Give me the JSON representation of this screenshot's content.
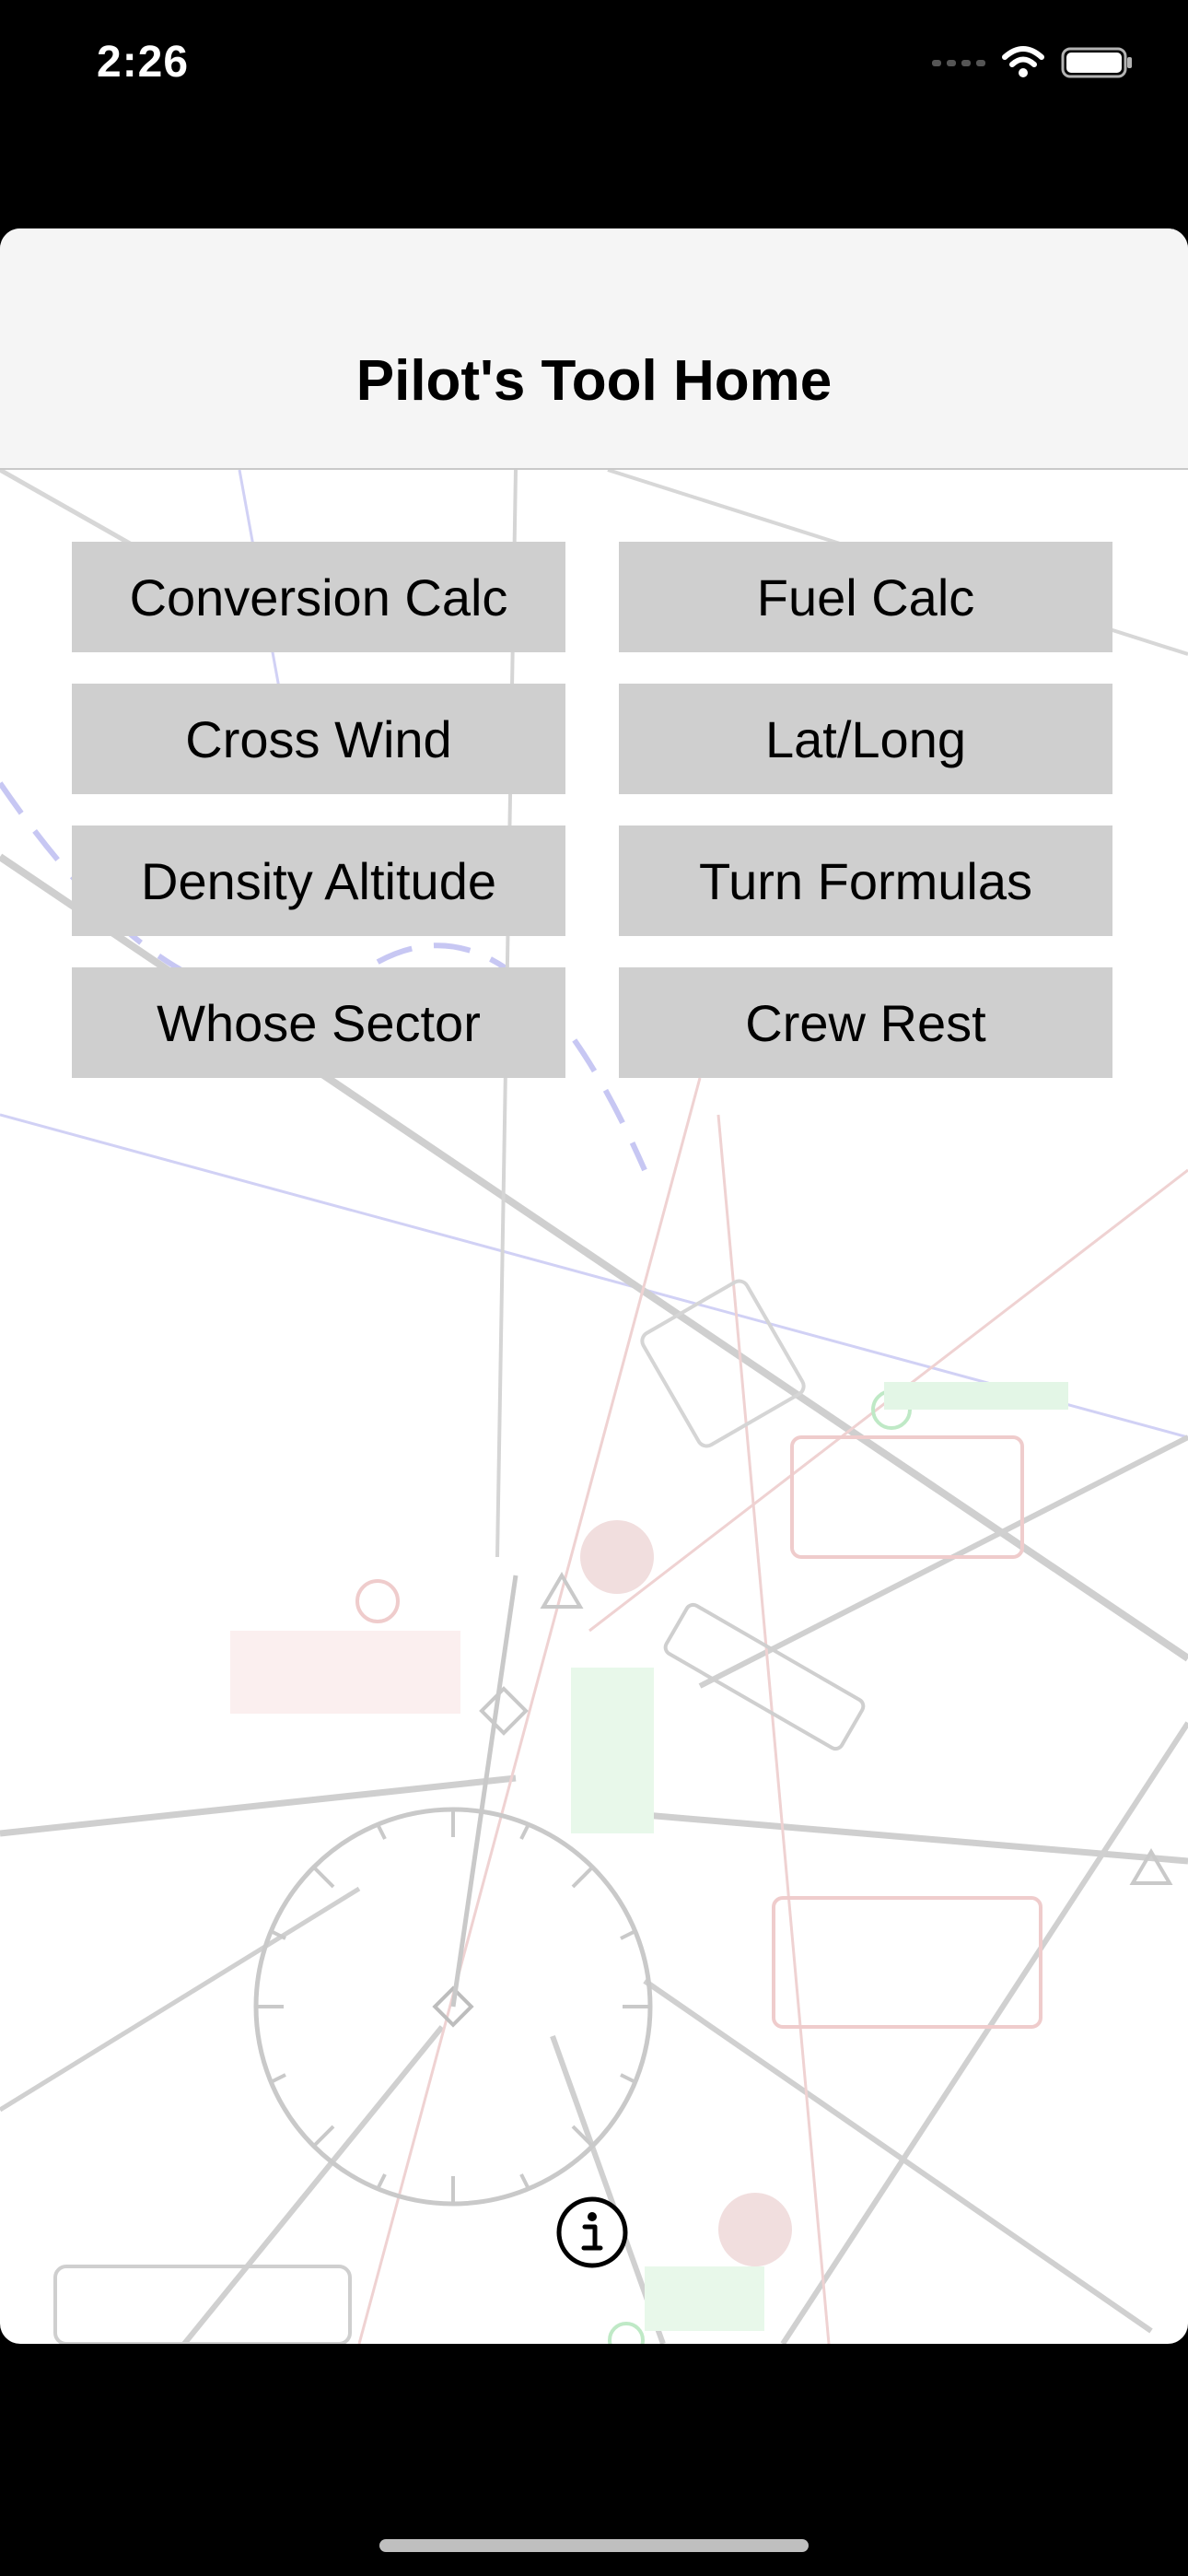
{
  "status_bar": {
    "time": "2:26",
    "wifi_icon": "wifi-icon",
    "battery_icon": "battery-icon"
  },
  "nav": {
    "title": "Pilot's Tool Home"
  },
  "buttons": [
    {
      "label": "Conversion Calc"
    },
    {
      "label": "Fuel Calc"
    },
    {
      "label": "Cross Wind"
    },
    {
      "label": "Lat/Long"
    },
    {
      "label": "Density Altitude"
    },
    {
      "label": "Turn Formulas"
    },
    {
      "label": "Whose Sector"
    },
    {
      "label": "Crew Rest"
    }
  ],
  "info_icon": "info-icon",
  "colors": {
    "button_bg": "#cfcfcf",
    "nav_bg": "#f5f5f5",
    "chart_lines": "#bdbdbd",
    "chart_blue": "#a9a9f0",
    "chart_green": "#8fdc9a",
    "chart_red": "#e7b1b1"
  }
}
